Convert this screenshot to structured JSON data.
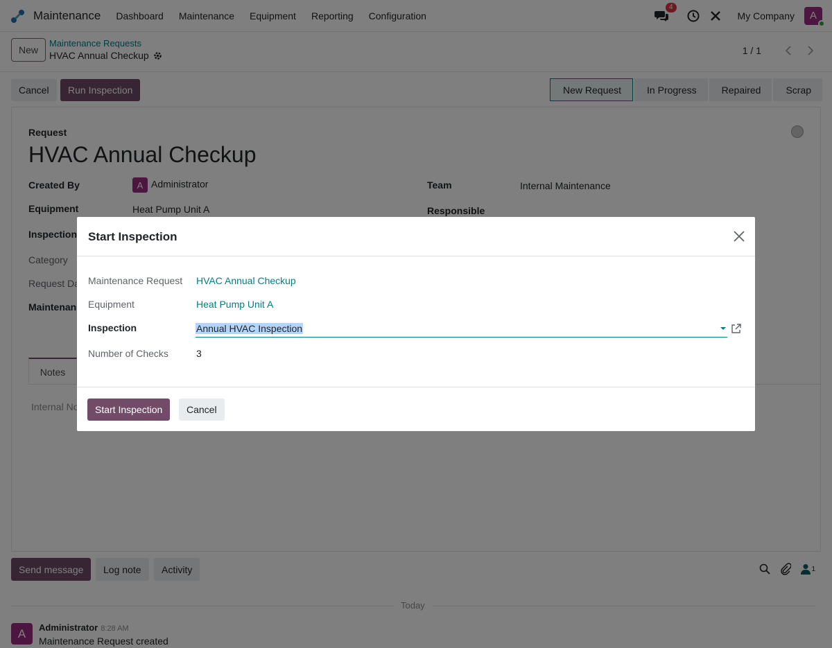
{
  "navbar": {
    "app_name": "Maintenance",
    "menu": [
      "Dashboard",
      "Maintenance",
      "Equipment",
      "Reporting",
      "Configuration"
    ],
    "messages_count": "4",
    "company": "My Company",
    "user_initial": "A"
  },
  "control": {
    "new_label": "New",
    "breadcrumb_parent": "Maintenance Requests",
    "breadcrumb_current": "HVAC Annual Checkup",
    "pager": "1 / 1"
  },
  "actions": {
    "cancel": "Cancel",
    "run_inspection": "Run Inspection",
    "stages": [
      "New Request",
      "In Progress",
      "Repaired",
      "Scrap"
    ]
  },
  "form": {
    "request_label": "Request",
    "title": "HVAC Annual Checkup",
    "created_by_label": "Created By",
    "created_by_initial": "A",
    "created_by": "Administrator",
    "equipment_label": "Equipment",
    "equipment": "Heat Pump Unit A",
    "inspection_label": "Inspection",
    "category_label": "Category",
    "request_date_label": "Request Da",
    "maintenance_label": "Maintenan",
    "team_label": "Team",
    "team": "Internal Maintenance",
    "responsible_label": "Responsible",
    "tab_notes": "Notes",
    "notes_placeholder": "Internal No"
  },
  "chatter": {
    "send_message": "Send message",
    "log_note": "Log note",
    "activity": "Activity",
    "followers_count": "1",
    "today": "Today",
    "message_initial": "A",
    "message_author": "Administrator",
    "message_time": "8:28 AM",
    "message_body": "Maintenance Request created"
  },
  "modal": {
    "title": "Start Inspection",
    "fields": {
      "maintenance_request_label": "Maintenance Request",
      "maintenance_request": "HVAC Annual Checkup",
      "equipment_label": "Equipment",
      "equipment": "Heat Pump Unit A",
      "inspection_label": "Inspection",
      "inspection": "Annual HVAC Inspection",
      "checks_label": "Number of Checks",
      "checks": "3"
    },
    "start_button": "Start Inspection",
    "cancel_button": "Cancel"
  },
  "colors": {
    "primary": "#714b67",
    "link": "#017e84",
    "avatar": "#9b2c80"
  }
}
